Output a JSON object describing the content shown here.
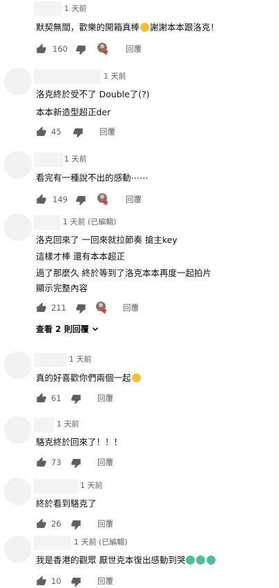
{
  "comments": [
    {
      "time": "1 天前",
      "lines": [
        "默契無間，歡樂的開箱真棒",
        "謝謝本本跟洛克！"
      ],
      "likes": "160",
      "reply": "回覆"
    },
    {
      "time": "1 天前",
      "lines": [
        "洛克終於受不了 Double了(?)",
        "本本新造型超正der"
      ],
      "likes": "45",
      "reply": "回覆"
    },
    {
      "time": "1 天前",
      "lines": [
        "看完有一種說不出的感動⋯⋯"
      ],
      "likes": "149",
      "reply": "回覆"
    },
    {
      "time": "1 天前 (已編輯)",
      "lines": [
        "洛克回來了 一回來就拉節奏 搶主key",
        "這樣才棒 還有本本超正",
        "過了那麼久 終於等到了洛克本本再度一起拍片",
        "顯示完整內容"
      ],
      "likes": "211",
      "reply": "回覆",
      "replies_toggle": "查看 2 則回覆"
    },
    {
      "time": "1 天前",
      "lines": [
        "真的好喜歡你們兩個一起"
      ],
      "likes": "61",
      "reply": "回覆"
    },
    {
      "time": "1 天前",
      "lines": [
        "駱克終於回來了！！！"
      ],
      "likes": "73",
      "reply": "回覆"
    },
    {
      "time": "1 天前",
      "lines": [
        "終於看到駱克了"
      ],
      "likes": "26",
      "reply": "回覆"
    },
    {
      "time": "1 天前 (已編輯)",
      "lines": [
        "我是香港的觀眾 厭世克本復出感動到哭"
      ],
      "likes": "10",
      "reply": "回覆"
    }
  ],
  "icons": {
    "like": "thumb-up-icon",
    "dislike": "thumb-down-icon",
    "creator_heart": "creator-heart-icon",
    "chevron": "chevron-down-icon"
  },
  "colors": {
    "meta_text": "#606060",
    "heart": "#e53935",
    "placeholder": "#f2f2f2"
  }
}
